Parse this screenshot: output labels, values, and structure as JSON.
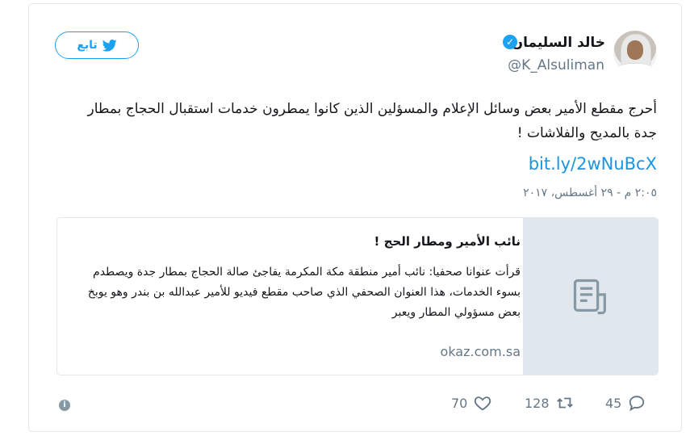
{
  "user": {
    "name": "خالد السليمان",
    "handle": "@K_Alsuliman",
    "verified_icon": "verified-badge-icon"
  },
  "follow_button": {
    "label": "تابع",
    "icon": "twitter-bird-icon"
  },
  "tweet": {
    "text": "أحرج مقطع الأمير بعض وسائل الإعلام والمسؤلين الذين كانوا يمطرون خدمات استقبال الحجاج بمطار جدة بالمديح والفلاشات !",
    "link": "bit.ly/2wNuBcX",
    "timestamp": "٢:٠٥ م - ٢٩ أغسطس، ٢٠١٧"
  },
  "link_card": {
    "title": "نائب الأمير ومطار الحج !",
    "description": "قرأت عنوانا صحفيا: نائب أمير منطقة مكة المكرمة يفاجئ صالة الحجاج بمطار جدة ويصطدم بسوء الخدمات، هذا العنوان الصحفي الذي صاحب مقطع فيديو للأمير عبدالله بن بندر وهو يوبخ بعض مسؤولي المطار ويعبر",
    "domain": "okaz.com.sa",
    "thumb_icon": "document-icon"
  },
  "actions": {
    "replies": "45",
    "retweets": "128",
    "likes": "70"
  },
  "colors": {
    "accent": "#1da1f2",
    "link": "#1b95e0",
    "muted": "#657786",
    "border": "#e1e8ed"
  }
}
